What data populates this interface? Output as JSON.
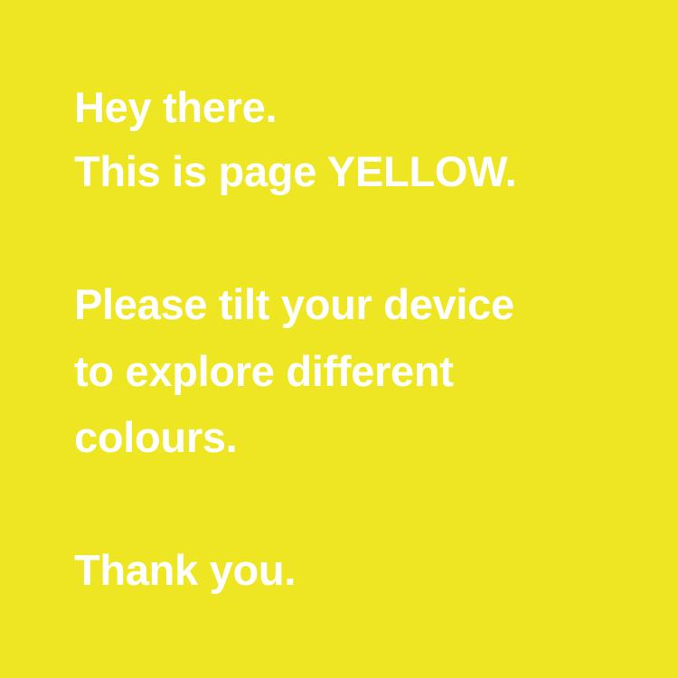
{
  "page": {
    "background_color": "#eee623",
    "text_color": "#ffffff",
    "greeting": {
      "line1": "Hey there.",
      "line2": "This is page YELLOW."
    },
    "instruction": {
      "line1": "Please tilt your device",
      "line2": "to explore different",
      "line3": "colours."
    },
    "closing": "Thank you."
  }
}
